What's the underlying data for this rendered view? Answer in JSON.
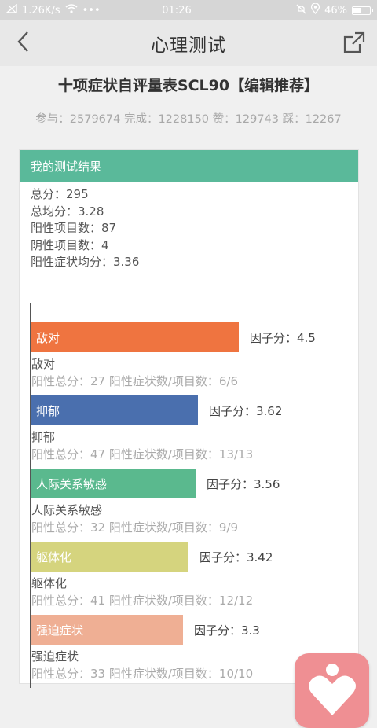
{
  "status_bar": {
    "speed": "1.26K/s",
    "time": "01:26",
    "battery": "46%",
    "battery_level": 0.46
  },
  "nav": {
    "title": "心理测试"
  },
  "scale": {
    "title": "十项症状自评量表SCL90【编辑推荐】",
    "stats": "参与：2579674 完成：1228150 赞：129743 踩：12267"
  },
  "result": {
    "header": "我的测试结果",
    "summary": [
      "总分：295",
      "总均分：3.28",
      "阳性项目数：87",
      "阴性项目数：4",
      "阳性症状均分：3.36"
    ]
  },
  "colors": {
    "accent": "#5ab99a"
  },
  "factors": [
    {
      "name": "敌对",
      "score_text": "因子分：4.5",
      "score": 4.5,
      "detail": "阳性总分：27    阳性症状数/项目数：6/6",
      "color": "#ef7440"
    },
    {
      "name": "抑郁",
      "score_text": "因子分：3.62",
      "score": 3.62,
      "detail": "阳性总分：47    阳性症状数/项目数：13/13",
      "color": "#4a6fae"
    },
    {
      "name": "人际关系敏感",
      "score_text": "因子分：3.56",
      "score": 3.56,
      "detail": "阳性总分：32    阳性症状数/项目数：9/9",
      "color": "#5ab98e"
    },
    {
      "name": "躯体化",
      "score_text": "因子分：3.42",
      "score": 3.42,
      "detail": "阳性总分：41    阳性症状数/项目数：12/12",
      "color": "#d5d47e"
    },
    {
      "name": "强迫症状",
      "score_text": "因子分：3.3",
      "score": 3.3,
      "detail": "阳性总分：33    阳性症状数/项目数：10/10",
      "color": "#efaf94"
    }
  ]
}
